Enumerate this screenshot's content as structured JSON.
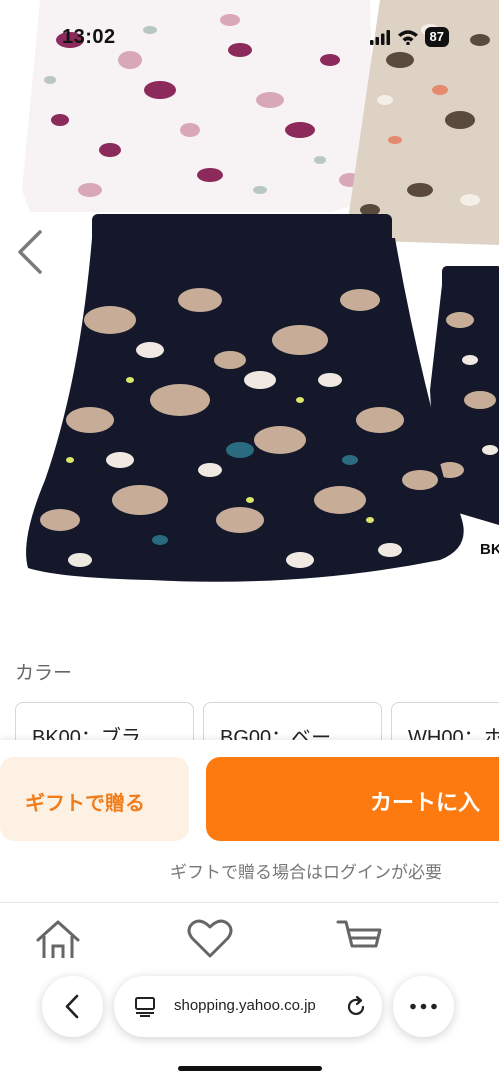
{
  "status_bar": {
    "time": "13:02",
    "battery": "87",
    "icons": [
      "signal-icon",
      "wifi-icon",
      "battery-icon"
    ]
  },
  "product_gallery": {
    "current_variant_code": "BK",
    "nav_icons": [
      "chevron-left-icon"
    ]
  },
  "color_section": {
    "heading": "カラー",
    "options": [
      {
        "label": "BK00：ブラ"
      },
      {
        "label": "BG00：ベー"
      },
      {
        "label": "WH00：ホ"
      }
    ]
  },
  "actions": {
    "gift_label": "ギフトで贈る",
    "cart_label": "カートに入",
    "login_note": "ギフトで贈る場合はログインが必要"
  },
  "bottom_nav": {
    "icons": [
      "home-icon",
      "heart-icon",
      "cart-icon"
    ]
  },
  "browser": {
    "url": "shopping.yahoo.co.jp",
    "icons": [
      "back-icon",
      "tabs-icon",
      "reload-icon",
      "more-icon"
    ]
  },
  "colors": {
    "accent_orange": "#fd7a10",
    "gift_bg": "#fdf1e4",
    "gift_text": "#ef7d1b",
    "skirt_dark": "#14182a"
  }
}
